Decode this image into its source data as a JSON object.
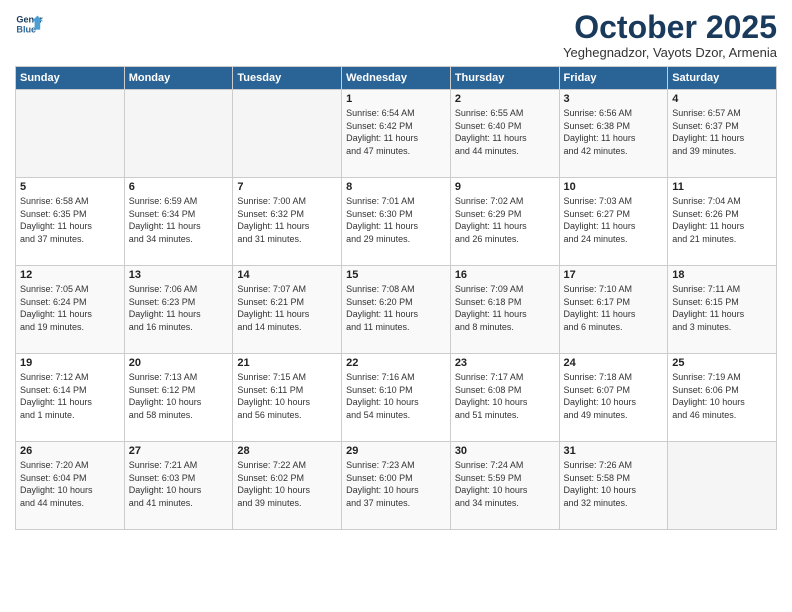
{
  "header": {
    "logo_line1": "General",
    "logo_line2": "Blue",
    "month": "October 2025",
    "location": "Yeghegnadzor, Vayots Dzor, Armenia"
  },
  "weekdays": [
    "Sunday",
    "Monday",
    "Tuesday",
    "Wednesday",
    "Thursday",
    "Friday",
    "Saturday"
  ],
  "weeks": [
    [
      {
        "day": "",
        "info": ""
      },
      {
        "day": "",
        "info": ""
      },
      {
        "day": "",
        "info": ""
      },
      {
        "day": "1",
        "info": "Sunrise: 6:54 AM\nSunset: 6:42 PM\nDaylight: 11 hours\nand 47 minutes."
      },
      {
        "day": "2",
        "info": "Sunrise: 6:55 AM\nSunset: 6:40 PM\nDaylight: 11 hours\nand 44 minutes."
      },
      {
        "day": "3",
        "info": "Sunrise: 6:56 AM\nSunset: 6:38 PM\nDaylight: 11 hours\nand 42 minutes."
      },
      {
        "day": "4",
        "info": "Sunrise: 6:57 AM\nSunset: 6:37 PM\nDaylight: 11 hours\nand 39 minutes."
      }
    ],
    [
      {
        "day": "5",
        "info": "Sunrise: 6:58 AM\nSunset: 6:35 PM\nDaylight: 11 hours\nand 37 minutes."
      },
      {
        "day": "6",
        "info": "Sunrise: 6:59 AM\nSunset: 6:34 PM\nDaylight: 11 hours\nand 34 minutes."
      },
      {
        "day": "7",
        "info": "Sunrise: 7:00 AM\nSunset: 6:32 PM\nDaylight: 11 hours\nand 31 minutes."
      },
      {
        "day": "8",
        "info": "Sunrise: 7:01 AM\nSunset: 6:30 PM\nDaylight: 11 hours\nand 29 minutes."
      },
      {
        "day": "9",
        "info": "Sunrise: 7:02 AM\nSunset: 6:29 PM\nDaylight: 11 hours\nand 26 minutes."
      },
      {
        "day": "10",
        "info": "Sunrise: 7:03 AM\nSunset: 6:27 PM\nDaylight: 11 hours\nand 24 minutes."
      },
      {
        "day": "11",
        "info": "Sunrise: 7:04 AM\nSunset: 6:26 PM\nDaylight: 11 hours\nand 21 minutes."
      }
    ],
    [
      {
        "day": "12",
        "info": "Sunrise: 7:05 AM\nSunset: 6:24 PM\nDaylight: 11 hours\nand 19 minutes."
      },
      {
        "day": "13",
        "info": "Sunrise: 7:06 AM\nSunset: 6:23 PM\nDaylight: 11 hours\nand 16 minutes."
      },
      {
        "day": "14",
        "info": "Sunrise: 7:07 AM\nSunset: 6:21 PM\nDaylight: 11 hours\nand 14 minutes."
      },
      {
        "day": "15",
        "info": "Sunrise: 7:08 AM\nSunset: 6:20 PM\nDaylight: 11 hours\nand 11 minutes."
      },
      {
        "day": "16",
        "info": "Sunrise: 7:09 AM\nSunset: 6:18 PM\nDaylight: 11 hours\nand 8 minutes."
      },
      {
        "day": "17",
        "info": "Sunrise: 7:10 AM\nSunset: 6:17 PM\nDaylight: 11 hours\nand 6 minutes."
      },
      {
        "day": "18",
        "info": "Sunrise: 7:11 AM\nSunset: 6:15 PM\nDaylight: 11 hours\nand 3 minutes."
      }
    ],
    [
      {
        "day": "19",
        "info": "Sunrise: 7:12 AM\nSunset: 6:14 PM\nDaylight: 11 hours\nand 1 minute."
      },
      {
        "day": "20",
        "info": "Sunrise: 7:13 AM\nSunset: 6:12 PM\nDaylight: 10 hours\nand 58 minutes."
      },
      {
        "day": "21",
        "info": "Sunrise: 7:15 AM\nSunset: 6:11 PM\nDaylight: 10 hours\nand 56 minutes."
      },
      {
        "day": "22",
        "info": "Sunrise: 7:16 AM\nSunset: 6:10 PM\nDaylight: 10 hours\nand 54 minutes."
      },
      {
        "day": "23",
        "info": "Sunrise: 7:17 AM\nSunset: 6:08 PM\nDaylight: 10 hours\nand 51 minutes."
      },
      {
        "day": "24",
        "info": "Sunrise: 7:18 AM\nSunset: 6:07 PM\nDaylight: 10 hours\nand 49 minutes."
      },
      {
        "day": "25",
        "info": "Sunrise: 7:19 AM\nSunset: 6:06 PM\nDaylight: 10 hours\nand 46 minutes."
      }
    ],
    [
      {
        "day": "26",
        "info": "Sunrise: 7:20 AM\nSunset: 6:04 PM\nDaylight: 10 hours\nand 44 minutes."
      },
      {
        "day": "27",
        "info": "Sunrise: 7:21 AM\nSunset: 6:03 PM\nDaylight: 10 hours\nand 41 minutes."
      },
      {
        "day": "28",
        "info": "Sunrise: 7:22 AM\nSunset: 6:02 PM\nDaylight: 10 hours\nand 39 minutes."
      },
      {
        "day": "29",
        "info": "Sunrise: 7:23 AM\nSunset: 6:00 PM\nDaylight: 10 hours\nand 37 minutes."
      },
      {
        "day": "30",
        "info": "Sunrise: 7:24 AM\nSunset: 5:59 PM\nDaylight: 10 hours\nand 34 minutes."
      },
      {
        "day": "31",
        "info": "Sunrise: 7:26 AM\nSunset: 5:58 PM\nDaylight: 10 hours\nand 32 minutes."
      },
      {
        "day": "",
        "info": ""
      }
    ]
  ]
}
